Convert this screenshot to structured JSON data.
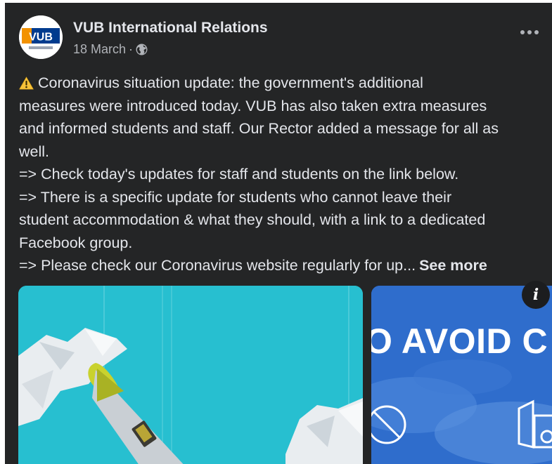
{
  "post": {
    "author": "VUB International Relations",
    "date": "18 March",
    "separator": "·",
    "privacy_icon": "globe-icon",
    "more_icon": "ellipsis-icon",
    "avatar": {
      "logo_text": "VUB"
    },
    "text_lines": [
      "Coronavirus situation update: the government's additional",
      "measures were introduced today. VUB has also taken extra measures",
      "and informed students and staff. Our Rector added a message for all as",
      "well.",
      "=> Check today's updates for staff and students on the link below.",
      "=> There is a specific update for students who cannot leave their",
      "student accommodation & what they should, with a link to a dedicated",
      "Facebook group.",
      "=> Please check our Coronavirus website regularly for up..."
    ],
    "see_more": "See more",
    "warning_icon": "warning-icon"
  },
  "media": {
    "image2_text": "O AVOID C",
    "info_label": "i"
  },
  "colors": {
    "card_bg": "#242526",
    "primary_text": "#e4e6eb",
    "secondary_text": "#b0b3b8",
    "image1_bg": "#27bfd0",
    "image2_bg": "#2f6dcc"
  }
}
